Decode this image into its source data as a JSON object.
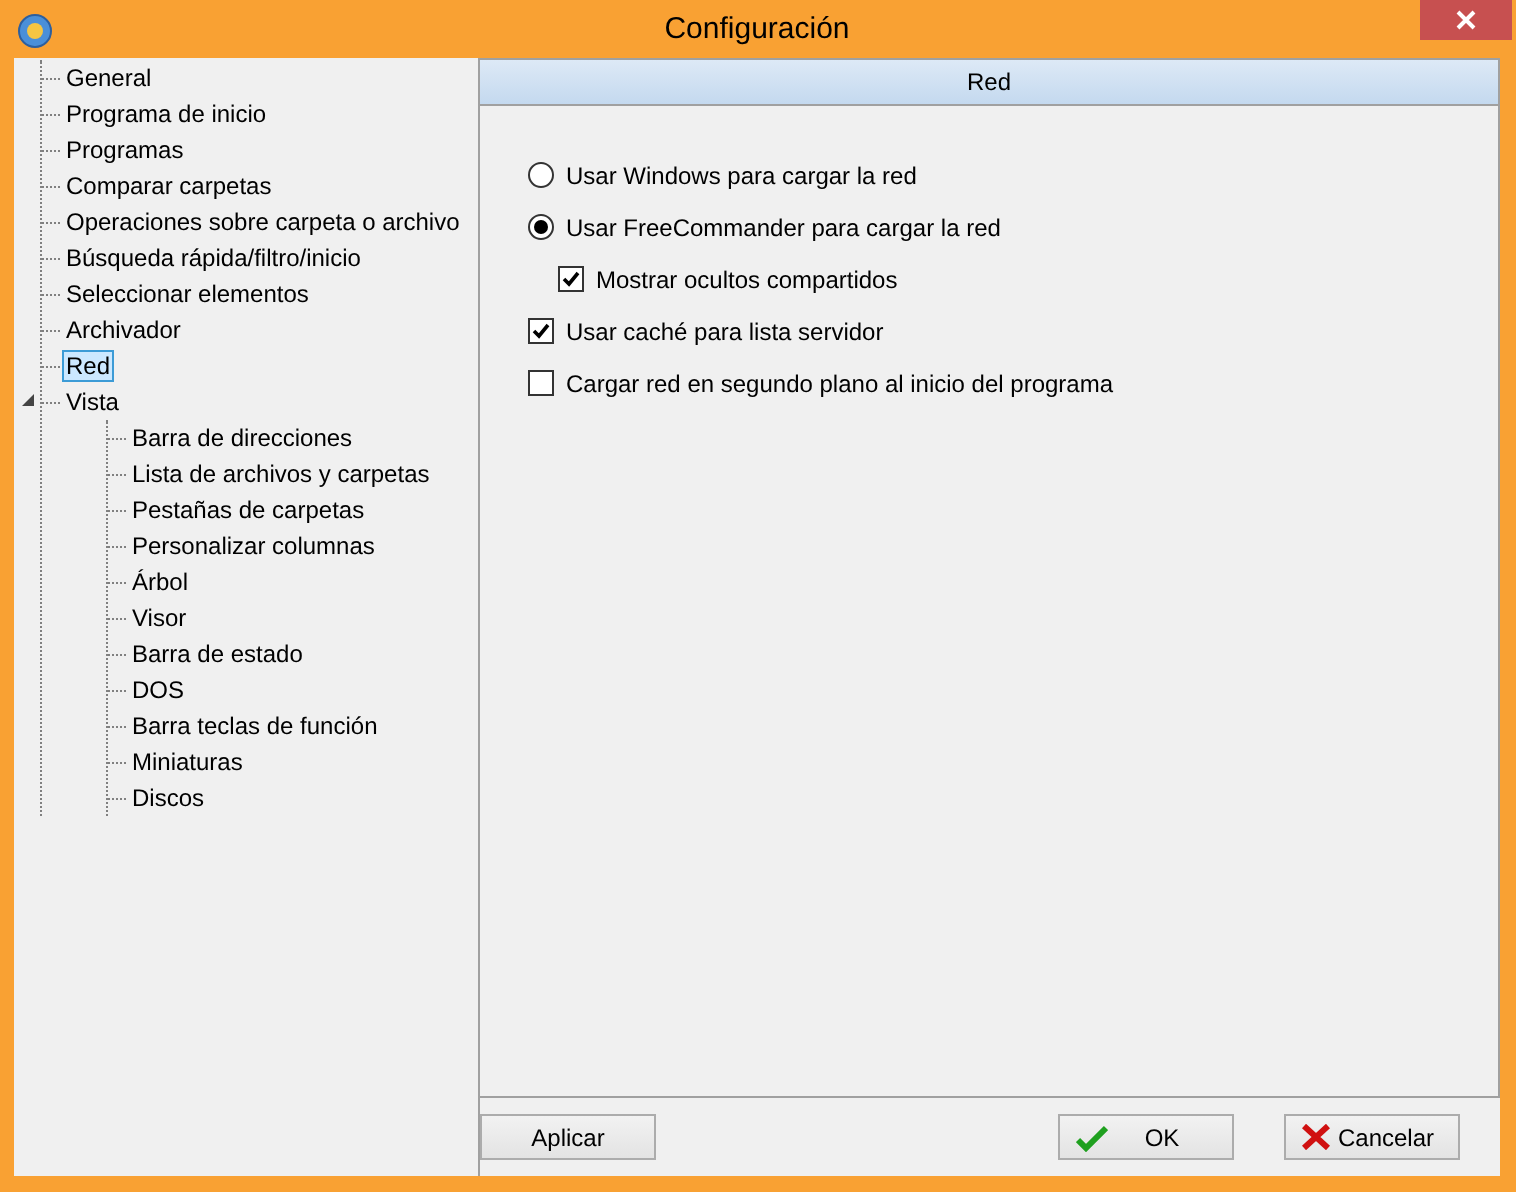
{
  "window": {
    "title": "Configuración"
  },
  "tree": [
    {
      "label": "General",
      "selected": false
    },
    {
      "label": "Programa de inicio",
      "selected": false
    },
    {
      "label": "Programas",
      "selected": false
    },
    {
      "label": "Comparar carpetas",
      "selected": false
    },
    {
      "label": "Operaciones sobre carpeta o archivo",
      "selected": false
    },
    {
      "label": "Búsqueda rápida/filtro/inicio",
      "selected": false
    },
    {
      "label": "Seleccionar elementos",
      "selected": false
    },
    {
      "label": "Archivador",
      "selected": false
    },
    {
      "label": "Red",
      "selected": true
    },
    {
      "label": "Vista",
      "selected": false,
      "expanded": true,
      "children": [
        {
          "label": "Barra de direcciones",
          "selected": false
        },
        {
          "label": "Lista de archivos y carpetas",
          "selected": false
        },
        {
          "label": "Pestañas de carpetas",
          "selected": false
        },
        {
          "label": "Personalizar columnas",
          "selected": false
        },
        {
          "label": "Árbol",
          "selected": false
        },
        {
          "label": "Visor",
          "selected": false
        },
        {
          "label": "Barra de estado",
          "selected": false
        },
        {
          "label": "DOS",
          "selected": false
        },
        {
          "label": "Barra teclas de función",
          "selected": false
        },
        {
          "label": "Miniaturas",
          "selected": false
        },
        {
          "label": "Discos",
          "selected": false
        }
      ]
    }
  ],
  "panel": {
    "title": "Red",
    "options": [
      {
        "kind": "radio",
        "label": "Usar Windows para cargar la red",
        "selected": false
      },
      {
        "kind": "radio",
        "label": "Usar FreeCommander para cargar la red",
        "selected": true,
        "children": [
          {
            "kind": "checkbox",
            "label": "Mostrar ocultos compartidos",
            "checked": true
          }
        ]
      },
      {
        "kind": "checkbox",
        "label": "Usar caché para lista servidor",
        "checked": true
      },
      {
        "kind": "checkbox",
        "label": "Cargar red en segundo plano al inicio del programa",
        "checked": false
      }
    ]
  },
  "buttons": [
    {
      "kind": "apply",
      "label": "Aplicar"
    },
    {
      "kind": "ok",
      "label": "OK"
    },
    {
      "kind": "cancel",
      "label": "Cancelar"
    }
  ]
}
